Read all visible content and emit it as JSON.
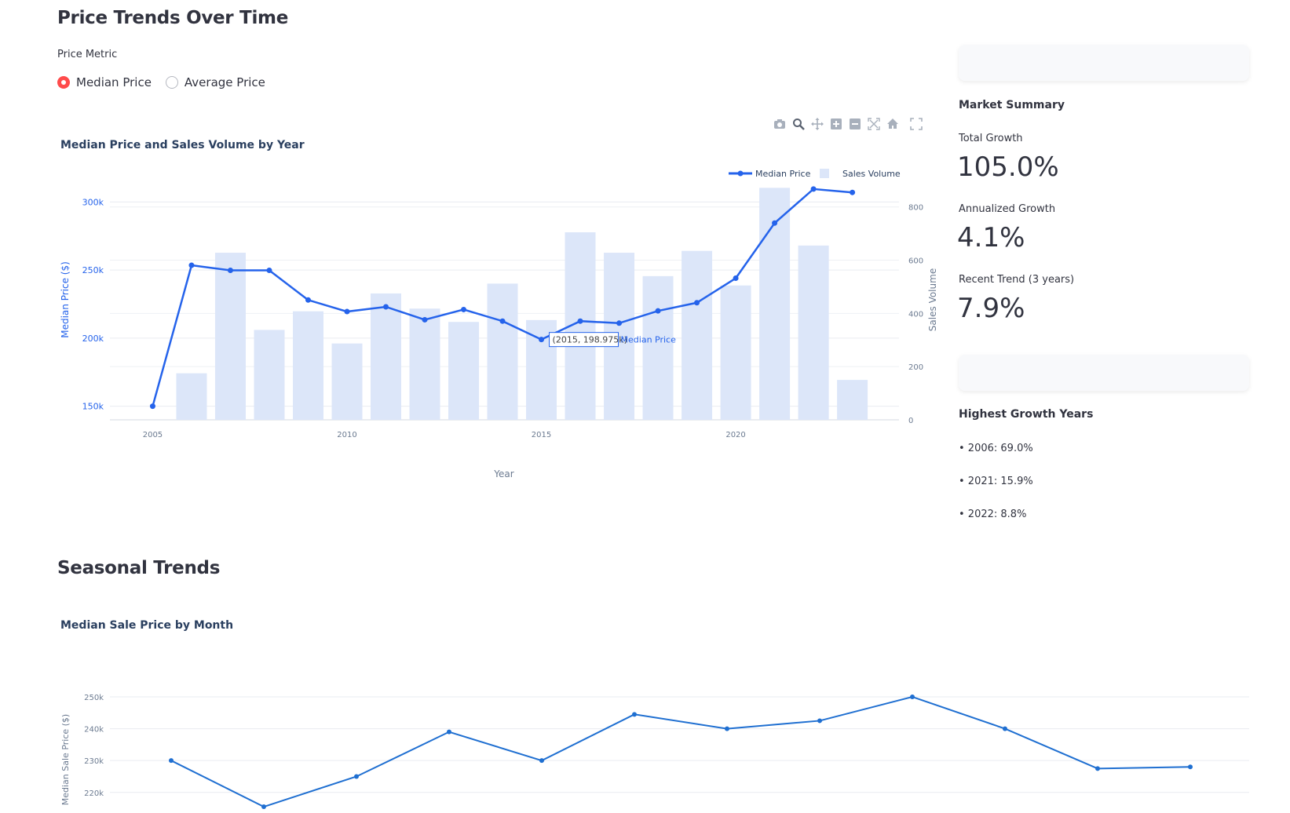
{
  "page": {
    "section1_title": "Price Trends Over Time",
    "section2_title": "Seasonal Trends"
  },
  "controls": {
    "metric_label": "Price Metric",
    "options": [
      {
        "label": "Median Price",
        "selected": true
      },
      {
        "label": "Average Price",
        "selected": false
      }
    ],
    "accent": "#ff4b4b"
  },
  "modebar": {
    "icons": [
      "camera-icon",
      "zoom-icon",
      "pan-icon",
      "zoom-in-icon",
      "zoom-out-icon",
      "autoscale-icon",
      "home-icon",
      "fullscreen-icon"
    ]
  },
  "sidebar": {
    "summary_title": "Market Summary",
    "metrics": [
      {
        "label": "Total Growth",
        "value": "105.0%"
      },
      {
        "label": "Annualized Growth",
        "value": "4.1%"
      },
      {
        "label": "Recent Trend (3 years)",
        "value": "7.9%"
      }
    ],
    "growth_title": "Highest Growth Years",
    "growth_years": [
      "• 2006: 69.0%",
      "• 2021: 15.9%",
      "• 2022: 8.8%"
    ]
  },
  "chart_data": [
    {
      "type": "line",
      "title": "Median Price and Sales Volume by Year",
      "xlabel": "Year",
      "ylabel": "Median Price ($)",
      "y2label": "Sales Volume",
      "x_ticks": [
        "2005",
        "2010",
        "2015",
        "2020"
      ],
      "y_ticks": [
        "150k",
        "200k",
        "250k",
        "300k"
      ],
      "y2_ticks": [
        "0",
        "200",
        "400",
        "600",
        "800"
      ],
      "ylim": [
        140000,
        310000
      ],
      "y2lim": [
        0,
        870
      ],
      "xlim": [
        2003.9,
        2024.2
      ],
      "legend_position": "top-right",
      "grid": true,
      "x": [
        2005,
        2006,
        2007,
        2008,
        2009,
        2010,
        2011,
        2012,
        2013,
        2014,
        2015,
        2016,
        2017,
        2018,
        2019,
        2020,
        2021,
        2022,
        2023
      ],
      "series": [
        {
          "name": "Median Price",
          "kind": "line",
          "color": "#2563eb",
          "x": [
            2005,
            2006,
            2007,
            2008,
            2009,
            2010,
            2011,
            2012,
            2013,
            2014,
            2015,
            2016,
            2017,
            2018,
            2019,
            2020,
            2021,
            2022,
            2023
          ],
          "values": [
            150000,
            253500,
            249800,
            249800,
            228000,
            219500,
            223000,
            213500,
            221000,
            212500,
            198975,
            212500,
            211000,
            220000,
            226000,
            244000,
            284500,
            309500,
            307000
          ]
        },
        {
          "name": "Sales Volume",
          "kind": "bar",
          "color": "#dce6f9",
          "x": [
            2006,
            2007,
            2008,
            2009,
            2010,
            2011,
            2012,
            2013,
            2014,
            2015,
            2016,
            2017,
            2018,
            2019,
            2020,
            2021,
            2022,
            2023
          ],
          "values": [
            175,
            628,
            338,
            408,
            287,
            475,
            418,
            368,
            512,
            375,
            705,
            628,
            540,
            635,
            505,
            872,
            655,
            150
          ]
        }
      ],
      "hover": {
        "text": "(2015, 198.975k)",
        "series": "Median Price"
      }
    },
    {
      "type": "line",
      "title": "Median Sale Price by Month",
      "ylabel": "Median Sale Price ($)",
      "y_ticks": [
        "220k",
        "230k",
        "240k",
        "250k"
      ],
      "ylim": [
        216000,
        250000
      ],
      "grid": true,
      "series": [
        {
          "name": "",
          "color": "#1f6fd1",
          "x": [
            1,
            2,
            3,
            4,
            5,
            6,
            7,
            8,
            9,
            10,
            11,
            12
          ],
          "values": [
            230000,
            215500,
            225000,
            239000,
            230000,
            244500,
            240000,
            242500,
            250000,
            240000,
            227500,
            228000
          ]
        }
      ]
    }
  ]
}
